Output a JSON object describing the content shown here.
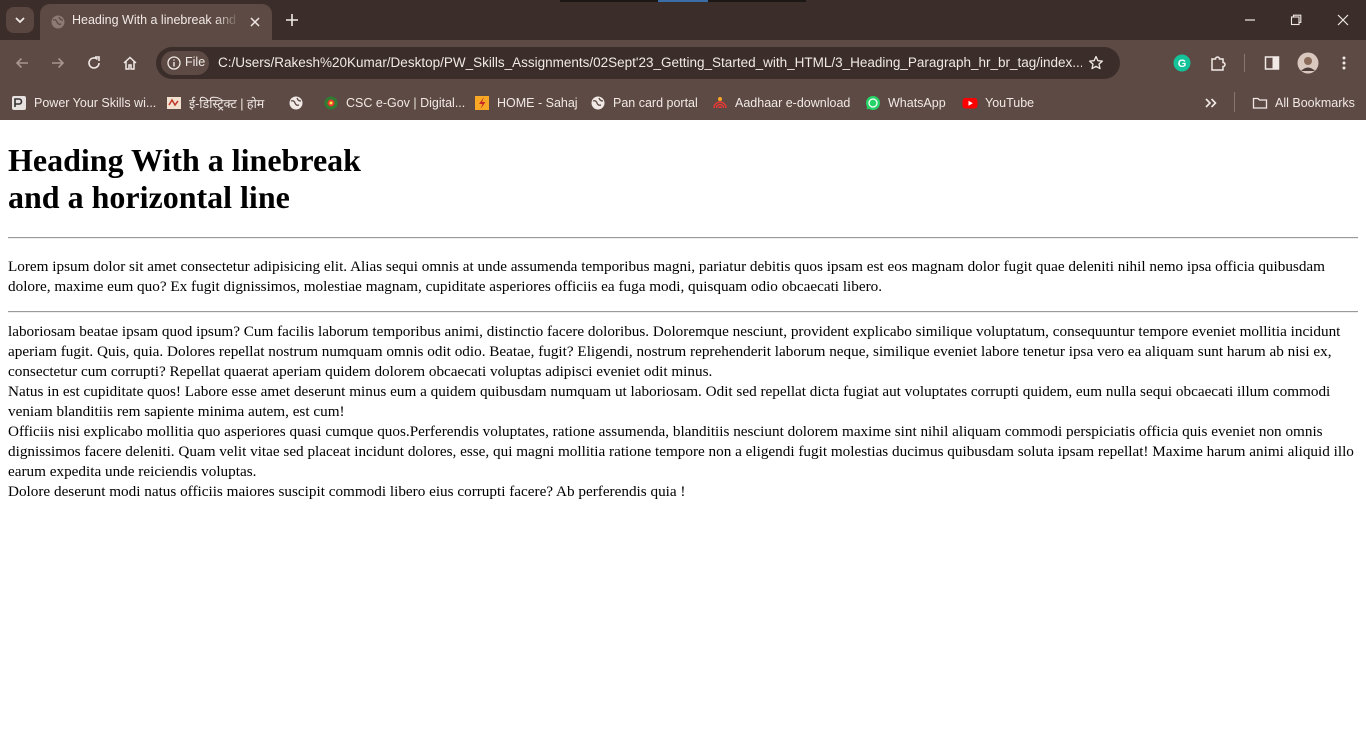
{
  "browser": {
    "tab": {
      "title": "Heading With a linebreak and a horizontal line"
    },
    "address_bar": {
      "scheme_chip": "File",
      "url": "C:/Users/Rakesh%20Kumar/Desktop/PW_Skills_Assignments/02Sept'23_Getting_Started_with_HTML/3_Heading_Paragraph_hr_br_tag/index..."
    },
    "bookmarks": [
      {
        "label": "Power Your Skills wi...",
        "icon": "pw-skills-icon"
      },
      {
        "label": "ई-डिस्ट्रिक्ट | होम",
        "icon": "e-district-icon"
      },
      {
        "label": "",
        "icon": "globe-icon"
      },
      {
        "label": "CSC e-Gov | Digital...",
        "icon": "csc-icon"
      },
      {
        "label": "HOME - Sahaj",
        "icon": "sahaj-icon"
      },
      {
        "label": "Pan card portal",
        "icon": "globe-icon"
      },
      {
        "label": "Aadhaar e-download",
        "icon": "aadhaar-icon"
      },
      {
        "label": "WhatsApp",
        "icon": "whatsapp-icon"
      },
      {
        "label": "YouTube",
        "icon": "youtube-icon"
      }
    ],
    "all_bookmarks_label": "All Bookmarks",
    "colors": {
      "frame": "#3b2e2a",
      "toolbar": "#5d4a44",
      "text": "#f1e9e6"
    }
  },
  "page": {
    "heading_line1": "Heading With a linebreak",
    "heading_line2": "and a horizontal line",
    "paragraph1": "Lorem ipsum dolor sit amet consectetur adipisicing elit. Alias sequi omnis at unde assumenda temporibus magni, pariatur debitis quos ipsam est eos magnam dolor fugit quae deleniti nihil nemo ipsa officia quibusdam dolore, maxime eum quo? Ex fugit dignissimos, molestiae magnam, cupiditate asperiores officiis ea fuga modi, quisquam odio obcaecati libero.",
    "paragraph2_lines": [
      "laboriosam beatae ipsam quod ipsum? Cum facilis laborum temporibus animi, distinctio facere doloribus. Doloremque nesciunt, provident explicabo similique voluptatum, consequuntur tempore eveniet mollitia incidunt aperiam fugit. Quis, quia. Dolores repellat nostrum numquam omnis odit odio. Beatae, fugit? Eligendi, nostrum reprehenderit laborum neque, similique eveniet labore tenetur ipsa vero ea aliquam sunt harum ab nisi ex, consectetur cum corrupti? Repellat quaerat aperiam quidem dolorem obcaecati voluptas adipisci eveniet odit minus.",
      "Natus in est cupiditate quos! Labore esse amet deserunt minus eum a quidem quibusdam numquam ut laboriosam. Odit sed repellat dicta fugiat aut voluptates corrupti quidem, eum nulla sequi obcaecati illum commodi veniam blanditiis rem sapiente minima autem, est cum!",
      "Officiis nisi explicabo mollitia quo asperiores quasi cumque quos.Perferendis voluptates, ratione assumenda, blanditiis nesciunt dolorem maxime sint nihil aliquam commodi perspiciatis officia quis eveniet non omnis dignissimos facere deleniti. Quam velit vitae sed placeat incidunt dolores, esse, qui magni mollitia ratione tempore non a eligendi fugit molestias ducimus quibusdam soluta ipsam repellat! Maxime harum animi aliquid illo earum expedita unde reiciendis voluptas.",
      "Dolore deserunt modi natus officiis maiores suscipit commodi libero eius corrupti facere? Ab perferendis quia !"
    ]
  }
}
